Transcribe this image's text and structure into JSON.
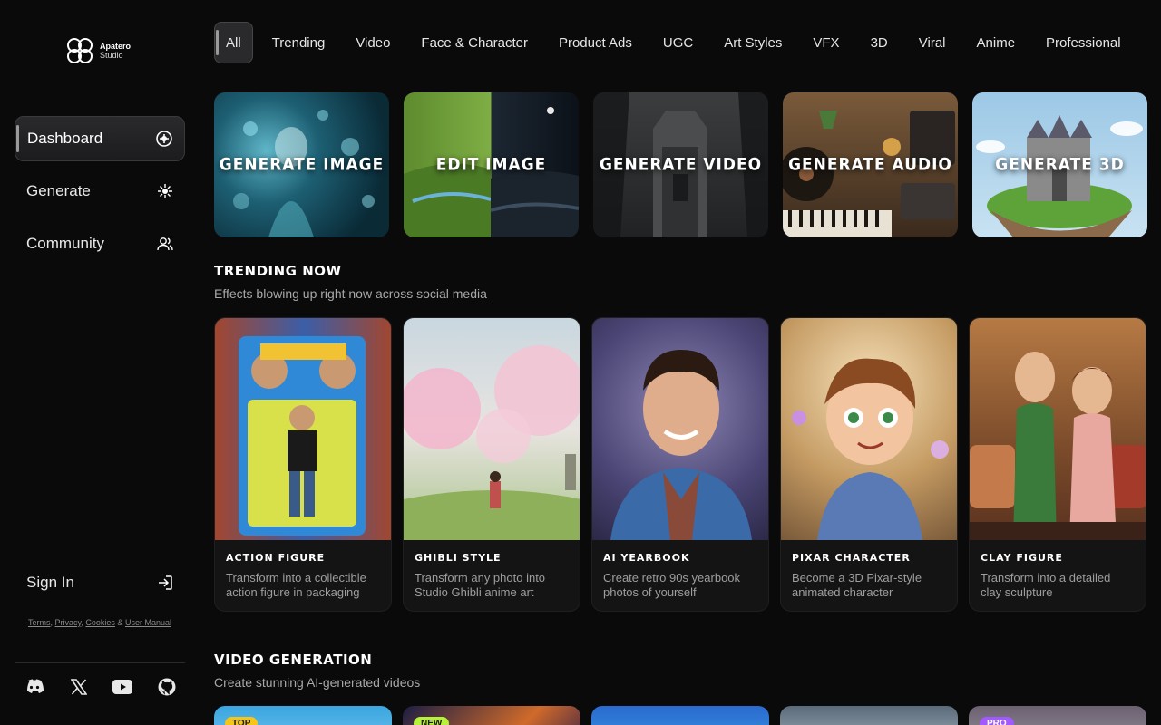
{
  "brand": {
    "line1": "Apatero",
    "line2": "Studio"
  },
  "sidebar": {
    "items": [
      {
        "label": "Dashboard",
        "icon": "dashboard-icon"
      },
      {
        "label": "Generate",
        "icon": "sparkle-icon"
      },
      {
        "label": "Community",
        "icon": "users-icon"
      }
    ],
    "signin_label": "Sign In",
    "legal": {
      "terms": "Terms",
      "privacy": "Privacy",
      "cookies": "Cookies",
      "amp": "&",
      "manual": "User Manual"
    },
    "socials": [
      "discord-icon",
      "x-icon",
      "youtube-icon",
      "github-icon"
    ]
  },
  "tabs": [
    "All",
    "Trending",
    "Video",
    "Face & Character",
    "Product Ads",
    "UGC",
    "Art Styles",
    "VFX",
    "3D",
    "Viral",
    "Anime",
    "Professional"
  ],
  "generators": [
    {
      "label": "GENERATE IMAGE"
    },
    {
      "label": "EDIT IMAGE"
    },
    {
      "label": "GENERATE VIDEO"
    },
    {
      "label": "GENERATE AUDIO"
    },
    {
      "label": "GENERATE 3D"
    }
  ],
  "trending": {
    "title": "TRENDING NOW",
    "subtitle": "Effects blowing up right now across social media",
    "cards": [
      {
        "title": "ACTION FIGURE",
        "desc": "Transform into a collectible action figure in packaging"
      },
      {
        "title": "GHIBLI STYLE",
        "desc": "Transform any photo into Studio Ghibli anime art"
      },
      {
        "title": "AI YEARBOOK",
        "desc": "Create retro 90s yearbook photos of yourself"
      },
      {
        "title": "PIXAR CHARACTER",
        "desc": "Become a 3D Pixar-style animated character"
      },
      {
        "title": "CLAY FIGURE",
        "desc": "Transform into a detailed clay sculpture"
      }
    ]
  },
  "video": {
    "title": "VIDEO GENERATION",
    "subtitle": "Create stunning AI-generated videos",
    "badges": [
      "TOP",
      "NEW",
      "",
      "",
      "PRO"
    ]
  },
  "colors": {
    "accent": "#2a2a2c",
    "badge_top": "#f5c518",
    "badge_new": "#b6f23a",
    "badge_pro": "#a259ff"
  }
}
